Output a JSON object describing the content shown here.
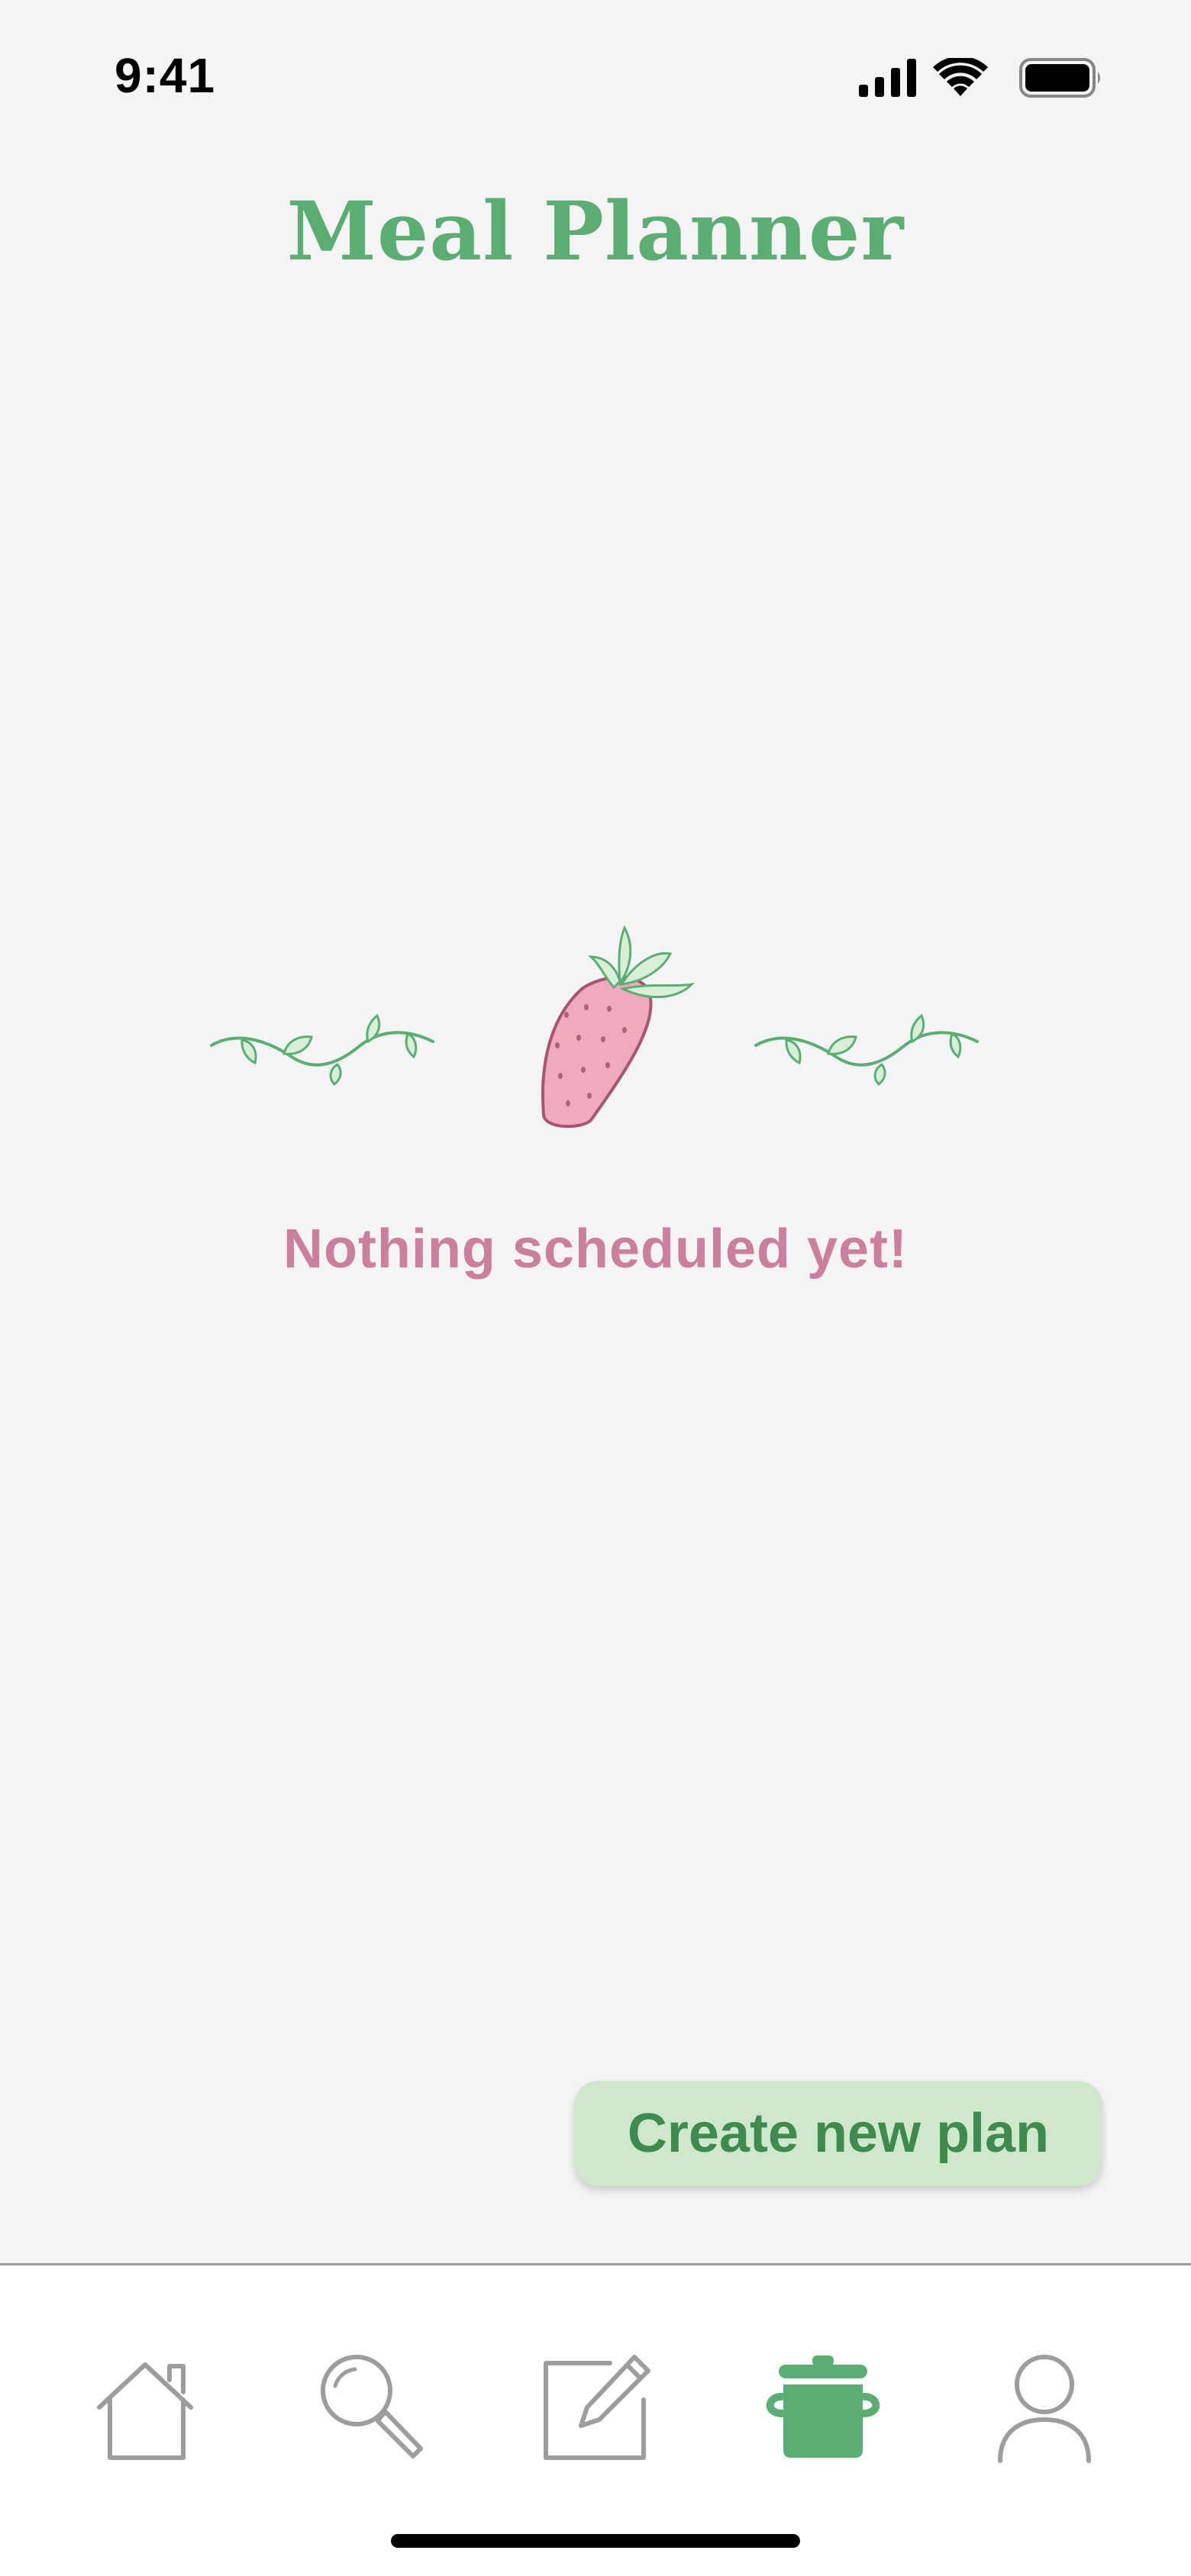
{
  "status_bar": {
    "time": "9:41",
    "icons": [
      "cellular-signal-icon",
      "wifi-icon",
      "battery-icon"
    ]
  },
  "header": {
    "title": "Meal Planner"
  },
  "empty_state": {
    "illustration": [
      "vine-icon",
      "strawberry-icon",
      "vine-icon"
    ],
    "message": "Nothing scheduled yet!"
  },
  "actions": {
    "create_plan_label": "Create new plan"
  },
  "tab_bar": {
    "items": [
      {
        "icon": "home-icon",
        "active": false
      },
      {
        "icon": "search-icon",
        "active": false
      },
      {
        "icon": "edit-icon",
        "active": false
      },
      {
        "icon": "cooking-pot-icon",
        "active": true
      },
      {
        "icon": "profile-icon",
        "active": false
      }
    ]
  },
  "colors": {
    "background": "#f4f4f4",
    "title_green": "#5bae73",
    "message_pink": "#cc7f9d",
    "button_background": "#cfe8cc",
    "button_text": "#3f8b4f",
    "tab_inactive": "#9d9d9d",
    "tab_active": "#5bae73",
    "strawberry_fill": "#f0aabd"
  }
}
